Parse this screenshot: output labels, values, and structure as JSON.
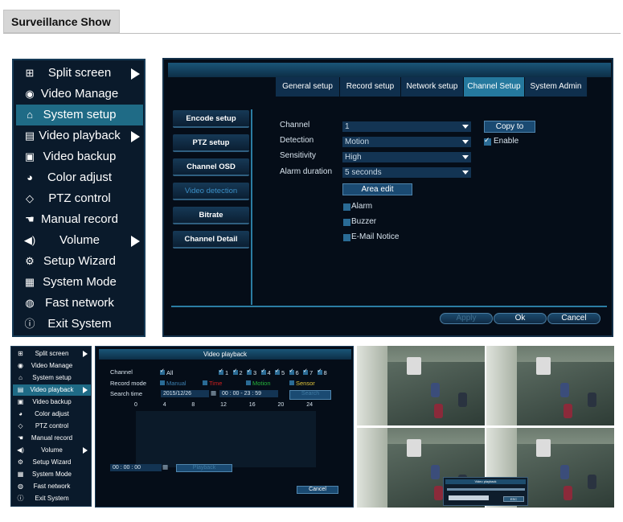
{
  "header": {
    "title": "Surveillance Show"
  },
  "menu": {
    "items": [
      {
        "label": "Split screen",
        "icon": "grid-icon",
        "glyph": "⊞",
        "arrow": true,
        "selected": false
      },
      {
        "label": "Video Manage",
        "icon": "camera-icon",
        "glyph": "◉",
        "arrow": false,
        "selected": false
      },
      {
        "label": "System setup",
        "icon": "home-icon",
        "glyph": "⌂",
        "arrow": false,
        "selected": true
      },
      {
        "label": "Video playback",
        "icon": "film-icon",
        "glyph": "▤",
        "arrow": true,
        "selected": false
      },
      {
        "label": "Video backup",
        "icon": "floppy-icon",
        "glyph": "▣",
        "arrow": false,
        "selected": false
      },
      {
        "label": "Color adjust",
        "icon": "pie-icon",
        "glyph": "◕",
        "arrow": false,
        "selected": false
      },
      {
        "label": "PTZ control",
        "icon": "diamond-icon",
        "glyph": "◇",
        "arrow": false,
        "selected": false
      },
      {
        "label": "Manual record",
        "icon": "hand-icon",
        "glyph": "☚",
        "arrow": false,
        "selected": false
      },
      {
        "label": "Volume",
        "icon": "speaker-icon",
        "glyph": "◀)",
        "arrow": true,
        "selected": false
      },
      {
        "label": "Setup Wizard",
        "icon": "gears-icon",
        "glyph": "⚙",
        "arrow": false,
        "selected": false
      },
      {
        "label": "System Mode",
        "icon": "document-icon",
        "glyph": "▦",
        "arrow": false,
        "selected": false
      },
      {
        "label": "Fast network",
        "icon": "globe-icon",
        "glyph": "◍",
        "arrow": false,
        "selected": false
      },
      {
        "label": "Exit System",
        "icon": "info-icon",
        "glyph": "ⓘ",
        "arrow": false,
        "selected": false
      }
    ]
  },
  "setup": {
    "tabs": [
      {
        "label": "General setup",
        "selected": false
      },
      {
        "label": "Record setup",
        "selected": false
      },
      {
        "label": "Network setup",
        "selected": false
      },
      {
        "label": "Channel Setup",
        "selected": true
      },
      {
        "label": "System Admin",
        "selected": false
      }
    ],
    "side_buttons": [
      {
        "label": "Encode setup",
        "selected": false
      },
      {
        "label": "PTZ setup",
        "selected": false
      },
      {
        "label": "Channel OSD",
        "selected": false
      },
      {
        "label": "Video detection",
        "selected": true
      },
      {
        "label": "Bitrate",
        "selected": false
      },
      {
        "label": "Channel Detail",
        "selected": false
      }
    ],
    "fields": {
      "channel_label": "Channel",
      "channel_value": "1",
      "detection_label": "Detection",
      "detection_value": "Motion",
      "sensitivity_label": "Sensitivity",
      "sensitivity_value": "High",
      "duration_label": "Alarm duration",
      "duration_value": "5 seconds"
    },
    "copy_to": "Copy to",
    "enable_label": "Enable",
    "area_edit": "Area edit",
    "options": {
      "alarm": "Alarm",
      "buzzer": "Buzzer",
      "email": "E-Mail Notice"
    },
    "bottom": {
      "apply": "Apply",
      "ok": "Ok",
      "cancel": "Cancel"
    }
  },
  "playback": {
    "title": "Video playback",
    "channel_label": "Channel",
    "all_label": "All",
    "channels": [
      "1",
      "2",
      "3",
      "4",
      "5",
      "6",
      "7",
      "8"
    ],
    "record_mode_label": "Record mode",
    "modes": [
      {
        "label": "Manual",
        "color": "#3c7fb0"
      },
      {
        "label": "Time",
        "color": "#d21f1f"
      },
      {
        "label": "Motion",
        "color": "#24b33a"
      },
      {
        "label": "Sensor",
        "color": "#e0c43a"
      }
    ],
    "search_time_label": "Search time",
    "date": "2015/12/26",
    "time_range": "00 : 00  -  23 : 59",
    "search": "Search",
    "hours": [
      "0",
      "4",
      "8",
      "12",
      "16",
      "20",
      "24"
    ],
    "start_time": "00 : 00 : 00",
    "playback_btn": "Playback",
    "cancel": "Cancel"
  },
  "preview": {
    "mini_title": "Video playback",
    "mini_button": "ESC"
  }
}
